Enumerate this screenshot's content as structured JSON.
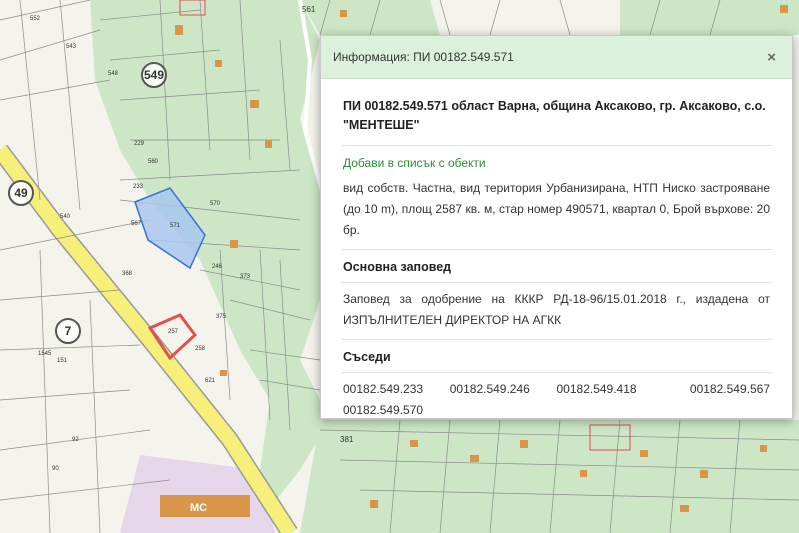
{
  "map": {
    "road_badges": [
      "549",
      "49",
      "7"
    ],
    "parcel_labels": [
      "229",
      "543",
      "540",
      "548",
      "560",
      "233",
      "567",
      "571",
      "570",
      "246",
      "373",
      "368",
      "257",
      "258",
      "621",
      "375",
      "1545",
      "151",
      "92",
      "90",
      "552"
    ],
    "road_numbers": [
      "561",
      "381"
    ],
    "poi_label": "МС",
    "colors": {
      "background": "#f4f4ec",
      "forest": "#cde6c6",
      "parcel_line": "#8c8c8c",
      "building": "#d9954a",
      "selected_fill": "#a9c6f0",
      "selected_stroke": "#3a6fd8",
      "highlight_stroke": "#e05050",
      "road": "#f6f07a"
    }
  },
  "panel": {
    "title": "Информация: ПИ 00182.549.571",
    "close_label": "×",
    "heading": "ПИ 00182.549.571 област Варна, община Аксаково, гр. Аксаково, с.о. \"МЕНТЕШЕ\"",
    "add_link": "Добави в списък с обекти",
    "description": "вид собств. Частна, вид територия Урбанизирана, НТП Ниско застрояване (до 10 m), площ 2587 кв. м, стар номер 490571, квартал 0, Брой върхове: 20 бр.",
    "order_title": "Основна заповед",
    "order_text": "Заповед за одобрение на КККР РД-18-96/15.01.2018 г., издадена от ИЗПЪЛНИТЕЛЕН ДИРЕКТОР НА АГКК",
    "neighbors_title": "Съседи",
    "neighbors": [
      "00182.549.233",
      "00182.549.246",
      "00182.549.418",
      "00182.549.567",
      "00182.549.570"
    ]
  }
}
